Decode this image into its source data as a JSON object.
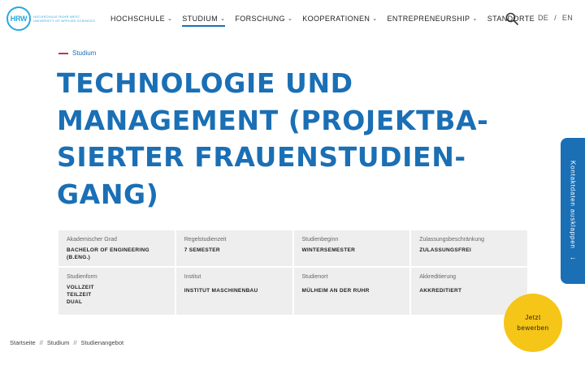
{
  "brand": {
    "logo_mark": "HRW",
    "logo_line1": "HOCHSCHULE RUHR WEST",
    "logo_line2": "UNIVERSITY OF APPLIED SCIENCES",
    "accent": "#1a6fb5",
    "logo_color": "#2aa8dc",
    "eyebrow_line_color": "#c0364b",
    "cta_color": "#f5c518"
  },
  "nav": {
    "items": [
      {
        "label": "HOCHSCHULE",
        "has_dropdown": true
      },
      {
        "label": "STUDIUM",
        "has_dropdown": true,
        "active": true
      },
      {
        "label": "FORSCHUNG",
        "has_dropdown": true
      },
      {
        "label": "KOOPERATIONEN",
        "has_dropdown": true
      },
      {
        "label": "ENTREPRENEURSHIP",
        "has_dropdown": true
      },
      {
        "label": "STANDORTE",
        "has_dropdown": false
      }
    ],
    "search_icon": "search-icon",
    "lang_de": "DE",
    "lang_sep": "/",
    "lang_en": "EN"
  },
  "page": {
    "eyebrow": "Studium",
    "title": "TECHNOLOGIE UND MANAGEMENT (PROJEKTBA-SIERTER FRAUENSTUDIEN-GANG)"
  },
  "info": {
    "row1": [
      {
        "label": "Akademischer Grad",
        "value": "BACHELOR OF ENGINEERING (B.ENG.)"
      },
      {
        "label": "Regelstudienzeit",
        "value": "7 SEMESTER"
      },
      {
        "label": "Studienbeginn",
        "value": "WINTERSEMESTER"
      },
      {
        "label": "Zulassungsbeschränkung",
        "value": "ZULASSUNGSFREI"
      }
    ],
    "row2": [
      {
        "label": "Studienform",
        "values": [
          "VOLLZEIT",
          "TEILZEIT",
          "DUAL"
        ]
      },
      {
        "label": "Institut",
        "value": "INSTITUT MASCHINENBAU"
      },
      {
        "label": "Studienort",
        "value": "MÜLHEIM AN DER RUHR"
      },
      {
        "label": "Akkreditierung",
        "value": "AKKREDITIERT"
      }
    ]
  },
  "breadcrumb": {
    "items": [
      "Startseite",
      "Studium",
      "Studienangebot"
    ],
    "separator": "//"
  },
  "side_tab": {
    "label": "Kontaktdaten ausklappen",
    "arrow": "←"
  },
  "cta": {
    "line1": "Jetzt",
    "line2": "bewerben"
  }
}
